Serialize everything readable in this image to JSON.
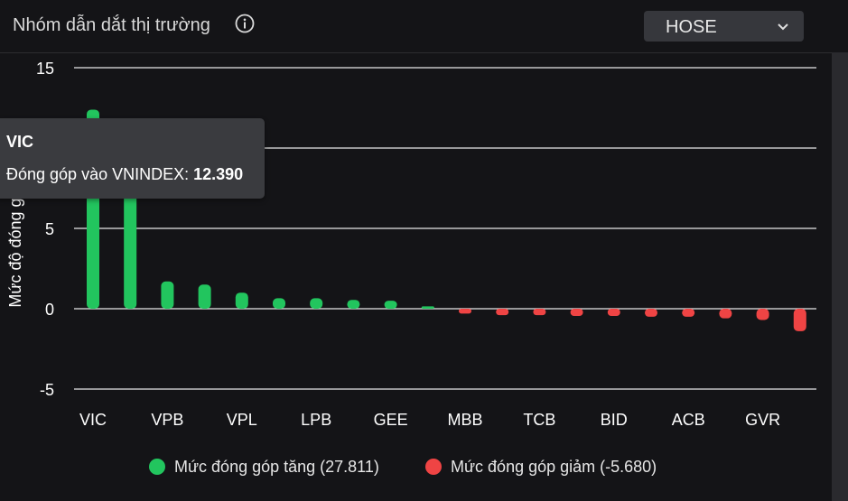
{
  "header": {
    "title": "Nhóm dẫn dắt thị trường",
    "info_icon": "info-icon",
    "exchange": "HOSE"
  },
  "tooltip": {
    "title": "VIC",
    "label": "Đóng góp vào VNINDEX:",
    "value": "12.390"
  },
  "legend": {
    "increase": "Mức đóng góp tăng (27.811)",
    "decrease": "Mức đóng góp giảm (-5.680)"
  },
  "colors": {
    "increase": "#22c55e",
    "decrease": "#ef4444",
    "grid": "#e8e8e8",
    "background": "#141417"
  },
  "chart_data": {
    "type": "bar",
    "ylabel": "Mức độ đóng góp",
    "ylim": [
      -5,
      15
    ],
    "yticks": [
      15,
      10,
      5,
      0,
      -5
    ],
    "ytick_labels_visible": [
      "15",
      "5",
      "0",
      "-5"
    ],
    "xtick_labels": [
      "VIC",
      "VPB",
      "VPL",
      "LPB",
      "GEE",
      "MBB",
      "TCB",
      "BID",
      "ACB",
      "GVR"
    ],
    "grid": true,
    "legend_position": "bottom",
    "series": [
      {
        "name": "Mức đóng góp tăng (27.811)",
        "color": "#22c55e",
        "values": [
          12.39,
          11.2,
          1.7,
          1.5,
          1.0,
          0.65,
          0.65,
          0.55,
          0.5,
          0.15
        ]
      },
      {
        "name": "Mức đóng góp giảm (-5.680)",
        "color": "#ef4444",
        "values": [
          -0.3,
          -0.4,
          -0.4,
          -0.45,
          -0.45,
          -0.5,
          -0.5,
          -0.6,
          -0.7,
          -1.4
        ]
      }
    ]
  }
}
